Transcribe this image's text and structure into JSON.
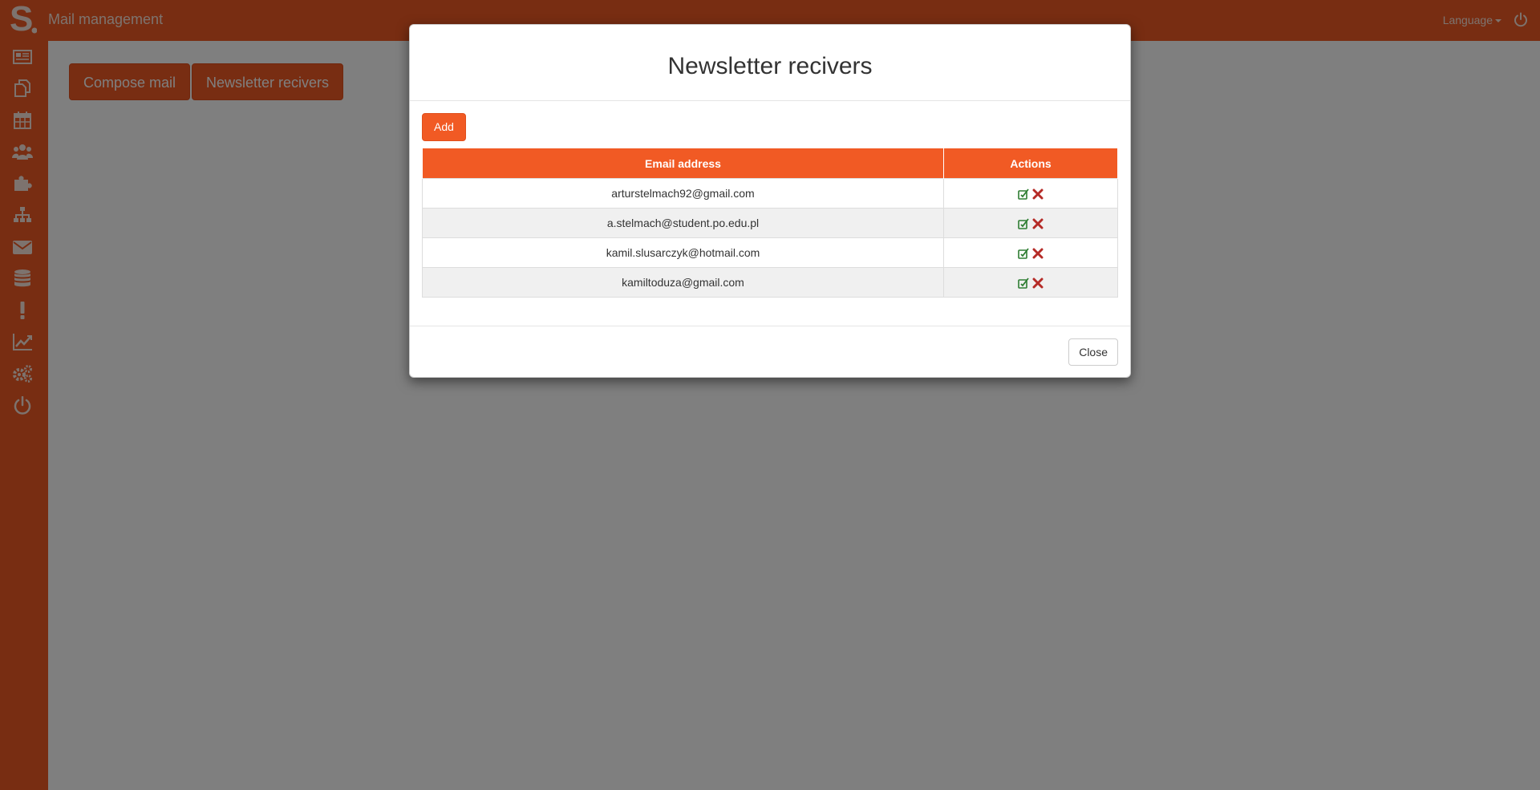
{
  "app": {
    "logo_letter": "S.",
    "title": "Mail management",
    "language_label": "Language"
  },
  "sidebar": {
    "items": [
      {
        "icon": "newspaper-icon"
      },
      {
        "icon": "copy-pages-icon"
      },
      {
        "icon": "calendar-icon"
      },
      {
        "icon": "users-icon"
      },
      {
        "icon": "puzzle-icon"
      },
      {
        "icon": "sitemap-icon"
      },
      {
        "icon": "envelope-icon"
      },
      {
        "icon": "database-icon"
      },
      {
        "icon": "exclamation-icon"
      },
      {
        "icon": "line-chart-icon"
      },
      {
        "icon": "gears-icon"
      },
      {
        "icon": "power-icon"
      }
    ]
  },
  "toolbar": {
    "compose_label": "Compose mail",
    "newsletter_label": "Newsletter recivers"
  },
  "modal": {
    "title": "Newsletter recivers",
    "add_label": "Add",
    "close_label": "Close",
    "columns": [
      "Email address",
      "Actions"
    ],
    "rows": [
      {
        "email": "arturstelmach92@gmail.com"
      },
      {
        "email": "a.stelmach@student.po.edu.pl"
      },
      {
        "email": "kamil.slusarczyk@hotmail.com"
      },
      {
        "email": "kamiltoduza@gmail.com"
      }
    ]
  },
  "colors": {
    "brand": "#f15a24",
    "edit_icon": "#2e7d32",
    "delete_icon": "#b52b27"
  }
}
